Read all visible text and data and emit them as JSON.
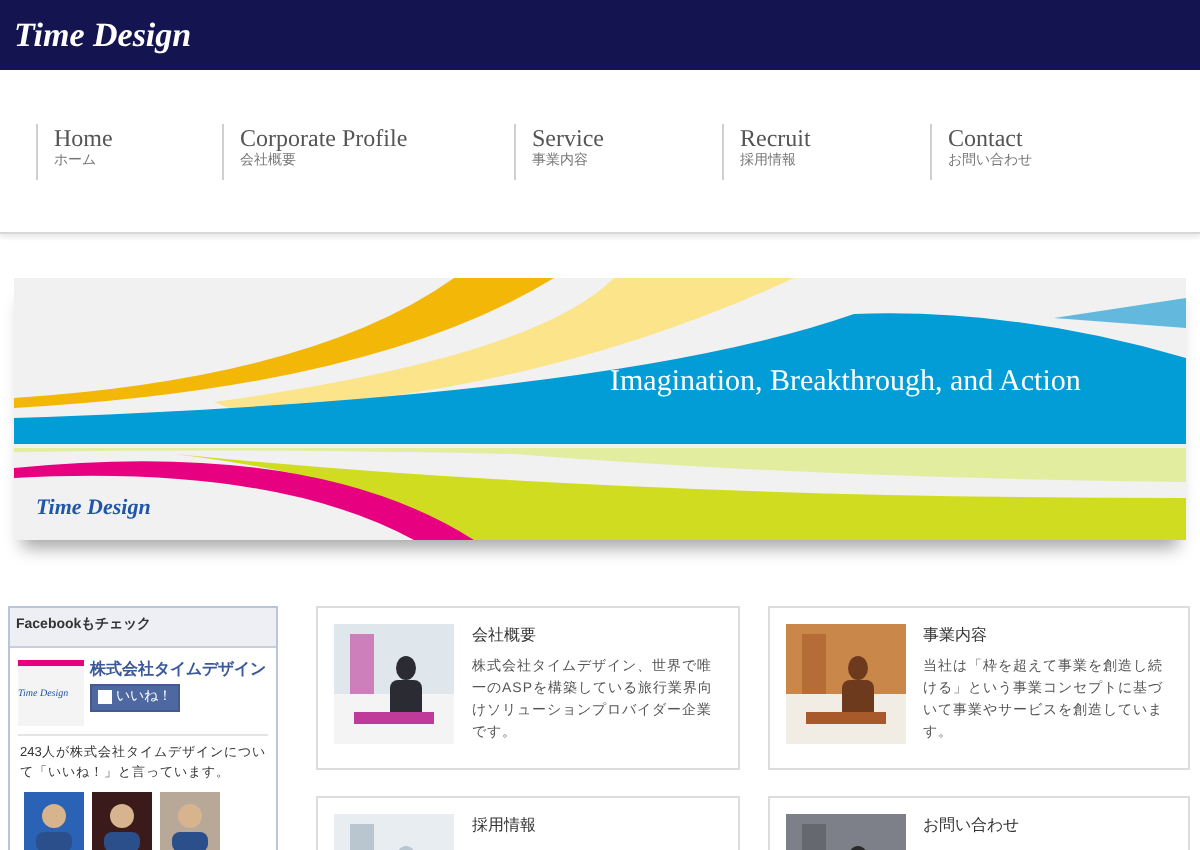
{
  "header": {
    "logo": "Time Design"
  },
  "nav": [
    {
      "label": "Home",
      "sub": "ホーム"
    },
    {
      "label": "Corporate Profile",
      "sub": "会社概要"
    },
    {
      "label": "Service",
      "sub": "事業内容"
    },
    {
      "label": "Recruit",
      "sub": "採用情報"
    },
    {
      "label": "Contact",
      "sub": "お問い合わせ"
    }
  ],
  "banner": {
    "tagline": "Imagination, Breakthrough, and Action",
    "logo": "Time Design"
  },
  "facebook": {
    "title": "Facebookもチェック",
    "page_name": "株式会社タイムデザイン",
    "like_button": "いいね！",
    "page_logo": "Time Design",
    "count_text": "243人が株式会社タイムデザインについて「いいね！」と言っています。"
  },
  "cards": [
    {
      "title": "会社概要",
      "text": "株式会社タイムデザイン、世界で唯一のASPを構築している旅行業界向けソリューションプロバイダー企業です。"
    },
    {
      "title": "事業内容",
      "text": "当社は「枠を超えて事業を創造し続ける」という事業コンセプトに基づいて事業やサービスを創造しています。"
    },
    {
      "title": "採用情報"
    },
    {
      "title": "お問い合わせ"
    }
  ]
}
